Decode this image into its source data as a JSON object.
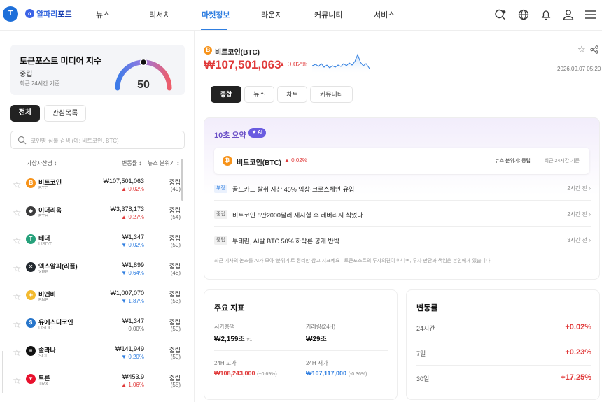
{
  "header": {
    "brand_pre": "알파리",
    "brand_post": "포트",
    "nav": [
      "뉴스",
      "리서치",
      "마켓정보",
      "라운지",
      "커뮤니티",
      "서비스"
    ],
    "active_nav": "마켓정보"
  },
  "index": {
    "title": "토큰포스트 미디어 지수",
    "status": "중립",
    "updated": "최근 24시간 기준",
    "value": "50"
  },
  "list_tabs": {
    "all": "전체",
    "watch": "관심목록"
  },
  "search": {
    "placeholder": "코인명·심볼 검색 (예: 비트코인, BTC)"
  },
  "table_headers": {
    "asset": "가상자산명 ↕",
    "change": "변동률 ↕",
    "sentiment": "뉴스 분위기 ↕"
  },
  "coins": [
    {
      "name": "비트코인",
      "symbol": "BTC",
      "price": "₩107,501,063",
      "change": "▲ 0.02%",
      "dir": "up",
      "sentiment": "중립",
      "count": "(49)",
      "color": "#f7931a",
      "glyph": "₿"
    },
    {
      "name": "이더리움",
      "symbol": "ETH",
      "price": "₩3,378,173",
      "change": "▲ 0.27%",
      "dir": "up",
      "sentiment": "중립",
      "count": "(54)",
      "color": "#3c3c3d",
      "glyph": "◆"
    },
    {
      "name": "테더",
      "symbol": "USDT",
      "price": "₩1,347",
      "change": "▼ 0.02%",
      "dir": "dn",
      "sentiment": "중립",
      "count": "(50)",
      "color": "#26a17b",
      "glyph": "T"
    },
    {
      "name": "엑스알피(리플)",
      "symbol": "XRP",
      "price": "₩1,899",
      "change": "▼ 0.64%",
      "dir": "dn",
      "sentiment": "중립",
      "count": "(48)",
      "color": "#23292f",
      "glyph": "✕"
    },
    {
      "name": "비앤비",
      "symbol": "BNB",
      "price": "₩1,007,070",
      "change": "▼ 1.87%",
      "dir": "dn",
      "sentiment": "중립",
      "count": "(53)",
      "color": "#f3ba2f",
      "glyph": "◈"
    },
    {
      "name": "유에스디코인",
      "symbol": "USDC",
      "price": "₩1,347",
      "change": "0.00%",
      "dir": "flat",
      "sentiment": "중립",
      "count": "(50)",
      "color": "#2775ca",
      "glyph": "$"
    },
    {
      "name": "솔라나",
      "symbol": "SOL",
      "price": "₩141,949",
      "change": "▼ 0.20%",
      "dir": "dn",
      "sentiment": "중립",
      "count": "(50)",
      "color": "#111111",
      "glyph": "≡"
    },
    {
      "name": "트론",
      "symbol": "TRX",
      "price": "₩453.9",
      "change": "▲ 1.06%",
      "dir": "up",
      "sentiment": "중립",
      "count": "(55)",
      "color": "#e8112d",
      "glyph": "▼"
    }
  ],
  "detail": {
    "title": "비트코인(BTC)",
    "price": "₩107,501,063",
    "change": "▲ 0.02%",
    "timestamp": "2026.09.07 05:20",
    "tabs": [
      "종합",
      "뉴스",
      "차트",
      "커뮤니티"
    ]
  },
  "ai": {
    "title": "10초 요약",
    "badge": "★ AI",
    "coin": "비트코인(BTC)",
    "change": "▲ 0.02%",
    "sentiment": "뉴스 분위기: 중립",
    "updated": "최근 24시간 기준",
    "news": [
      {
        "tag": "부정",
        "text": "골드카드 탈취 자산 45% 익상·크로스체인 유입",
        "time": "2시간 전 ›",
        "neg": true
      },
      {
        "tag": "중립",
        "text": "비트코인 8만2000달러 재시험 후 레버리지 식었다",
        "time": "2시간 전 ›",
        "neg": false
      },
      {
        "tag": "중립",
        "text": "부테린, AI발 BTC 50% 하락론 공개 반박",
        "time": "3시간 전 ›",
        "neg": false
      }
    ],
    "disclaimer": "최근 기사의 논조를 AI가 모아 '분위기'로 정리한 참고 지표예요 · 토큰포스트의 투자의견이 아니며, 투자 판단과 책임은 본인에게 있습니다"
  },
  "metrics": {
    "title": "주요 지표",
    "mcap_label": "시가총액",
    "mcap": "₩2,159조",
    "mcap_rank": "#1",
    "vol_label": "거래량(24H)",
    "vol": "₩29조",
    "high_label": "24H 고가",
    "high": "₩108,243,000",
    "high_pct": "(+0.69%)",
    "low_label": "24H 저가",
    "low": "₩107,117,000",
    "low_pct": "(-0.36%)"
  },
  "volatility": {
    "title": "변동률",
    "rows": [
      {
        "label": "24시간",
        "value": "+0.02%"
      },
      {
        "label": "7일",
        "value": "+0.23%"
      },
      {
        "label": "30일",
        "value": "+17.25%"
      }
    ]
  },
  "colors": {
    "accent": "#2f7ee0",
    "up": "#e03a3a",
    "down": "#2f7ee0",
    "ai": "#6a4fc7"
  }
}
